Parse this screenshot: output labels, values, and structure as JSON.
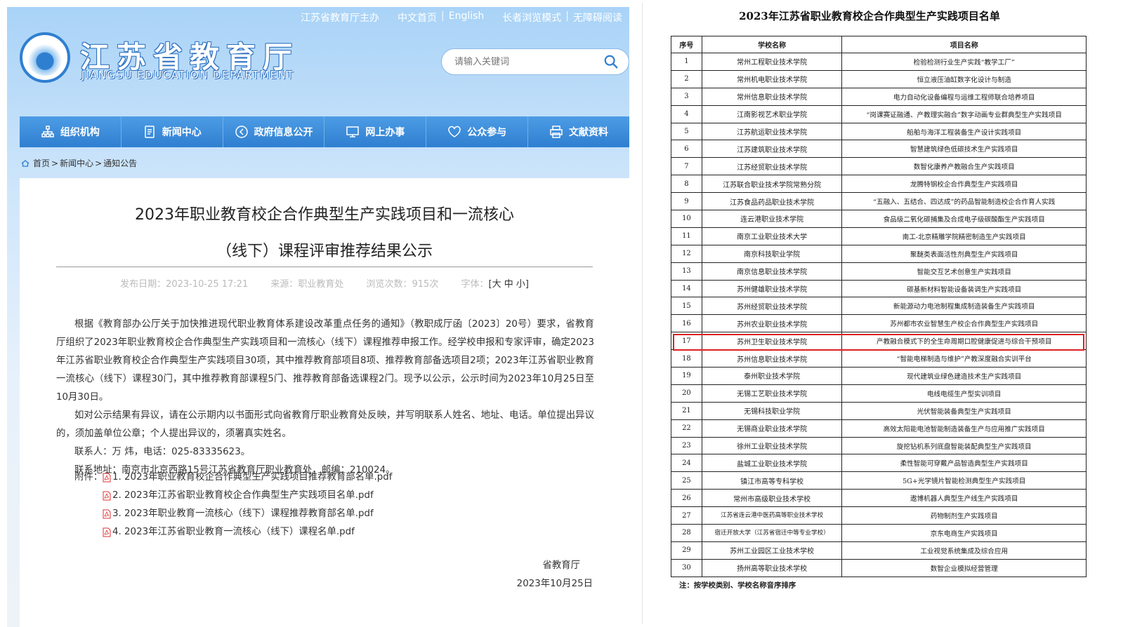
{
  "header": {
    "top_links": [
      "江苏省教育厅主办",
      "中文首页",
      "English",
      "长者浏览模式",
      "无障碍阅读"
    ],
    "site_title": "江苏省教育厅",
    "site_subtitle": "JIANGSU EDUCATION DEPARTMENT",
    "search_placeholder": "请输入关键词"
  },
  "nav": [
    {
      "label": "组织机构",
      "icon": "org-chart-icon"
    },
    {
      "label": "新闻中心",
      "icon": "document-icon"
    },
    {
      "label": "政府信息公开",
      "icon": "circle-play-icon"
    },
    {
      "label": "网上办事",
      "icon": "monitor-icon"
    },
    {
      "label": "公众参与",
      "icon": "heart-icon"
    },
    {
      "label": "文献资料",
      "icon": "printer-icon"
    }
  ],
  "breadcrumb": [
    "首页",
    "新闻中心",
    "通知公告"
  ],
  "article": {
    "title_line1": "2023年职业教育校企合作典型生产实践项目和一流核心",
    "title_line2": "（线下）课程评审推荐结果公示",
    "meta": {
      "publish_date": "发布日期：2023-10-25 17:21",
      "source": "来源：职业教育处",
      "views": "浏览次数：915次",
      "font_size_label": "字体：",
      "font_size_options": "[大 中 小]"
    },
    "paragraphs": [
      "根据《教育部办公厅关于加快推进现代职业教育体系建设改革重点任务的通知》（教职成厅函〔2023〕20号）要求，省教育厅组织了2023年职业教育校企合作典型生产实践项目和一流核心（线下）课程推荐申报工作。经学校申报和专家评审，确定2023年江苏省职业教育校企合作典型生产实践项目30项，其中推荐教育部项目8项、推荐教育部备选项目2项；2023年江苏省职业教育一流核心（线下）课程30门，其中推荐教育部课程5门、推荐教育部备选课程2门。现予以公示，公示时间为2023年10月25日至10月30日。",
      "如对公示结果有异议，请在公示期内以书面形式向省教育厅职业教育处反映，并写明联系人姓名、地址、电话。单位提出异议的，须加盖单位公章；个人提出异议的，须署真实姓名。",
      "联系人：万 炜，电话：025-83335623。",
      "联系地址：南京市北京西路15号江苏省教育厅职业教育处，邮编：210024。"
    ],
    "attachments_label": "附件：",
    "attachments": [
      "1. 2023年职业教育校企合作典型生产实践项目推荐教育部名单.pdf",
      "2. 2023年江苏省职业教育校企合作典型生产实践项目名单.pdf",
      "3. 2023年职业教育一流核心（线下）课程推荐教育部名单.pdf",
      "4. 2023年江苏省职业教育一流核心（线下）课程名单.pdf"
    ],
    "signer": "省教育厅",
    "date": "2023年10月25日"
  },
  "document": {
    "title": "2023年江苏省职业教育校企合作典型生产实践项目名单",
    "headers": [
      "序号",
      "学校名称",
      "项目名称"
    ],
    "rows": [
      [
        "1",
        "常州工程职业技术学院",
        "检验检测行业生产实践“教学工厂”"
      ],
      [
        "2",
        "常州机电职业技术学院",
        "恒立液压油缸数字化设计与制造"
      ],
      [
        "3",
        "常州信息职业技术学院",
        "电力自动化设备编程与运维工程师联合培养项目"
      ],
      [
        "4",
        "江南影视艺术职业学院",
        "“岗课赛证融通、产教理实融合”数字动画专业群典型生产实践项目"
      ],
      [
        "5",
        "江苏航运职业技术学院",
        "船舶与海洋工程装备生产设计实践项目"
      ],
      [
        "6",
        "江苏建筑职业技术学院",
        "智慧建筑绿色低碳技术生产实践项目"
      ],
      [
        "7",
        "江苏经贸职业技术学院",
        "数智化康养产教融合生产实践项目"
      ],
      [
        "8",
        "江苏联合职业技术学院常熟分院",
        "龙腾特钢校企合作典型生产实践项目"
      ],
      [
        "9",
        "江苏食品药品职业技术学院",
        "“五融入、五结合、四达成”的药品智能制造校企合作育人实践"
      ],
      [
        "10",
        "连云港职业技术学院",
        "食品级二氧化碳捕集及合成电子级碳酸酯生产实践项目"
      ],
      [
        "11",
        "南京工业职业技术大学",
        "南工-北京精雕学院精密制造生产实践项目"
      ],
      [
        "12",
        "南京科技职业学院",
        "聚醚类表面活性剂典型生产实践项目"
      ],
      [
        "13",
        "南京信息职业技术学院",
        "智能交互艺术创意生产实践项目"
      ],
      [
        "14",
        "苏州健雄职业技术学院",
        "碳基新材料智能设备装调生产实践项目"
      ],
      [
        "15",
        "苏州经贸职业技术学院",
        "新能源动力电池制程集成制造装备生产实践项目"
      ],
      [
        "16",
        "苏州农业职业技术学院",
        "苏州都市农业智慧生产校企合作典型生产实践项目"
      ],
      [
        "17",
        "苏州卫生职业技术学院",
        "产教融合模式下的全生命周期口腔健康促进与综合干预项目"
      ],
      [
        "18",
        "苏州信息职业技术学院",
        "“智能电梯制造与维护”产教深度融合实训平台"
      ],
      [
        "19",
        "泰州职业技术学院",
        "现代建筑业绿色建造技术生产实践项目"
      ],
      [
        "20",
        "无锡工艺职业技术学院",
        "电线电缆生产型实训项目"
      ],
      [
        "21",
        "无锡科技职业学院",
        "光伏智能装备典型生产实践项目"
      ],
      [
        "22",
        "无锡商业职业技术学院",
        "高效太阳能电池智能制造装备生产与应用推广实践项目"
      ],
      [
        "23",
        "徐州工业职业技术学院",
        "旋挖钻机系列底盘智能装配典型生产实践项目"
      ],
      [
        "24",
        "盐城工业职业技术学院",
        "柔性智能可穿戴产品智造典型生产实践项目"
      ],
      [
        "25",
        "镇江市高等专科学校",
        "5G+光学镜片智能检测典型生产实践项目"
      ],
      [
        "26",
        "常州市高级职业技术学校",
        "遨博机器人典型生产线生产实践项目"
      ],
      [
        "27",
        "江苏省连云港中医药高等职业技术学校",
        "药物制剂生产实践项目"
      ],
      [
        "28",
        "宿迁开放大学（江苏省宿迁中等专业学校）",
        "京东电商生产实践项目"
      ],
      [
        "29",
        "苏州工业园区工业技术学校",
        "工业视觉系统集成及综合应用"
      ],
      [
        "30",
        "扬州高等职业技术学校",
        "数智企业模拟经营管理"
      ]
    ],
    "note": "注：按学校类别、学校名称音序排序",
    "highlighted_row": "17"
  },
  "colors": {
    "nav_blue": "#2f7fd1",
    "header_sky": "#a9d3f7",
    "highlight_red": "#e02020"
  }
}
